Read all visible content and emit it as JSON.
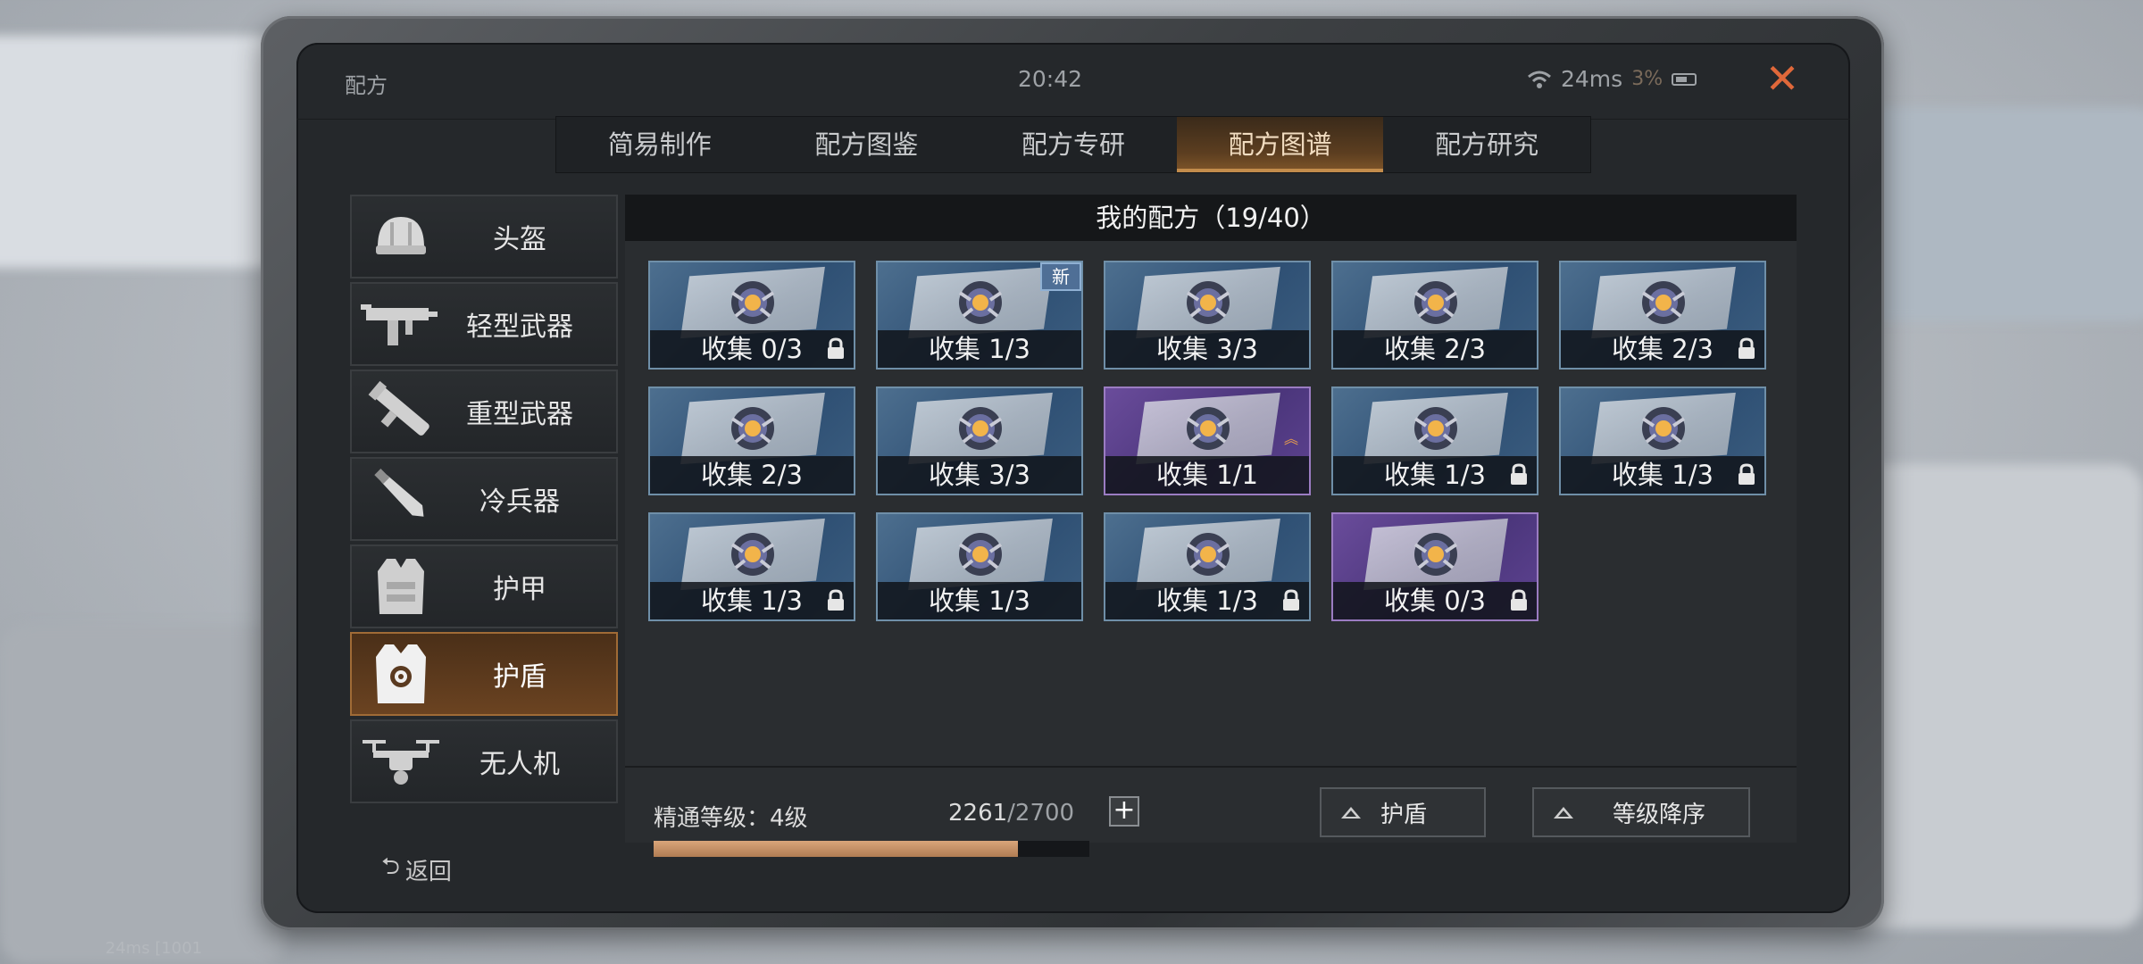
{
  "window": {
    "title": "配方",
    "clock": "20:42",
    "ping": "24ms",
    "battery": "3%"
  },
  "tabs": [
    {
      "label": "简易制作",
      "active": false
    },
    {
      "label": "配方图鉴",
      "active": false
    },
    {
      "label": "配方专研",
      "active": false
    },
    {
      "label": "配方图谱",
      "active": true
    },
    {
      "label": "配方研究",
      "active": false
    }
  ],
  "sidebar": {
    "items": [
      {
        "label": "头盔",
        "icon": "helmet-icon"
      },
      {
        "label": "轻型武器",
        "icon": "smg-icon"
      },
      {
        "label": "重型武器",
        "icon": "launcher-icon"
      },
      {
        "label": "冷兵器",
        "icon": "blade-icon"
      },
      {
        "label": "护甲",
        "icon": "vest-icon"
      },
      {
        "label": "护盾",
        "icon": "shield-vest-icon",
        "active": true
      },
      {
        "label": "无人机",
        "icon": "drone-icon"
      }
    ],
    "back_label": "返回"
  },
  "main": {
    "header": "我的配方（19/40）",
    "cards": [
      {
        "text": "收集 0/3",
        "rarity": "blue",
        "locked": true,
        "new": false
      },
      {
        "text": "收集 1/3",
        "rarity": "blue",
        "locked": false,
        "new": true
      },
      {
        "text": "收集 3/3",
        "rarity": "blue",
        "locked": false,
        "new": false
      },
      {
        "text": "收集 2/3",
        "rarity": "blue",
        "locked": false,
        "new": false
      },
      {
        "text": "收集 2/3",
        "rarity": "blue",
        "locked": true,
        "new": false
      },
      {
        "text": "收集 2/3",
        "rarity": "blue",
        "locked": false,
        "new": false
      },
      {
        "text": "收集 3/3",
        "rarity": "blue",
        "locked": false,
        "new": false
      },
      {
        "text": "收集 1/1",
        "rarity": "purple",
        "locked": false,
        "new": false,
        "upgrade": true
      },
      {
        "text": "收集 1/3",
        "rarity": "blue",
        "locked": true,
        "new": false
      },
      {
        "text": "收集 1/3",
        "rarity": "blue",
        "locked": true,
        "new": false
      },
      {
        "text": "收集 1/3",
        "rarity": "blue",
        "locked": true,
        "new": false
      },
      {
        "text": "收集 1/3",
        "rarity": "blue",
        "locked": false,
        "new": false
      },
      {
        "text": "收集 1/3",
        "rarity": "blue",
        "locked": true,
        "new": false
      },
      {
        "text": "收集 0/3",
        "rarity": "purple",
        "locked": true,
        "new": false
      }
    ],
    "new_badge": "新"
  },
  "footer": {
    "mastery_label": "精通等级：4级",
    "mastery_current": "2261",
    "mastery_max": "/2700",
    "mastery_fraction": 0.837,
    "filter_label": "护盾",
    "sort_label": "等级降序"
  },
  "debug_overlay": "24ms [1001",
  "colors": {
    "accent": "#c38c4c",
    "close": "#e0683a",
    "card_blue": "#2e4f73",
    "card_purple": "#4a357a",
    "progress": "#d9a57a"
  }
}
